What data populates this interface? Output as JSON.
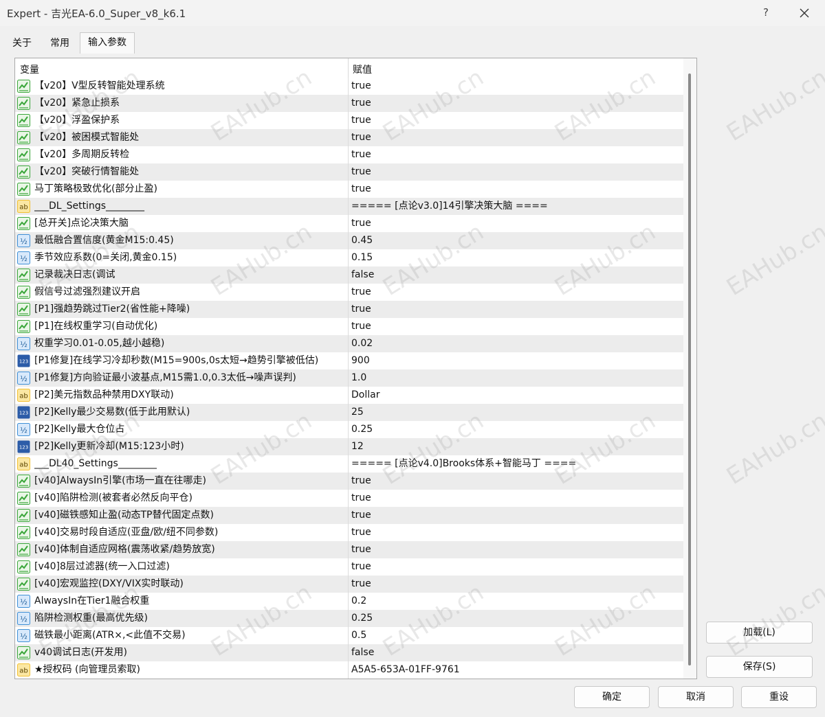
{
  "window": {
    "title": "Expert - 吉光EA-6.0_Super_v8_k6.1",
    "help_glyph": "?",
    "close_icon": "close-icon"
  },
  "tabs": [
    {
      "label": "关于",
      "active": false
    },
    {
      "label": "常用",
      "active": false
    },
    {
      "label": "输入参数",
      "active": true
    }
  ],
  "table": {
    "headers": {
      "variable": "变量",
      "value": "赋值"
    },
    "rows": [
      {
        "icon": "bool",
        "name": "【v20】V型反转智能处理系统",
        "value": "true"
      },
      {
        "icon": "bool",
        "name": "【v20】紧急止损系",
        "value": "true"
      },
      {
        "icon": "bool",
        "name": "【v20】浮盈保护系",
        "value": "true"
      },
      {
        "icon": "bool",
        "name": "【v20】被困模式智能处",
        "value": "true"
      },
      {
        "icon": "bool",
        "name": "【v20】多周期反转检",
        "value": "true"
      },
      {
        "icon": "bool",
        "name": "【v20】突破行情智能处",
        "value": "true"
      },
      {
        "icon": "bool",
        "name": "马丁策略极致优化(部分止盈)",
        "value": "true"
      },
      {
        "icon": "string",
        "name": "___DL_Settings________",
        "value": "===== [点论v3.0]14引擎决策大脑 ===="
      },
      {
        "icon": "bool",
        "name": "[总开关]点论决策大脑",
        "value": "true"
      },
      {
        "icon": "double",
        "name": "最低融合置信度(黄金M15:0.45)",
        "value": "0.45"
      },
      {
        "icon": "double",
        "name": "季节效应系数(0=关闭,黄金0.15)",
        "value": "0.15"
      },
      {
        "icon": "bool",
        "name": "记录裁决日志(调试",
        "value": "false"
      },
      {
        "icon": "bool",
        "name": "假信号过滤强烈建议开启",
        "value": "true"
      },
      {
        "icon": "bool",
        "name": "[P1]强趋势跳过Tier2(省性能+降噪)",
        "value": "true"
      },
      {
        "icon": "bool",
        "name": "[P1]在线权重学习(自动优化)",
        "value": "true"
      },
      {
        "icon": "double",
        "name": "权重学习0.01-0.05,越小越稳)",
        "value": "0.02"
      },
      {
        "icon": "int",
        "name": "[P1修复]在线学习冷却秒数(M15=900s,0s太短→趋势引擎被低估)",
        "value": "900"
      },
      {
        "icon": "double",
        "name": "[P1修复]方向验证最小波基点,M15需1.0,0.3太低→噪声误判)",
        "value": "1.0"
      },
      {
        "icon": "string",
        "name": "[P2]美元指数品种禁用DXY联动)",
        "value": "Dollar"
      },
      {
        "icon": "int",
        "name": "[P2]Kelly最少交易数(低于此用默认)",
        "value": "25"
      },
      {
        "icon": "double",
        "name": "[P2]Kelly最大仓位占",
        "value": "0.25"
      },
      {
        "icon": "int",
        "name": "[P2]Kelly更新冷却(M15:123小时)",
        "value": "12"
      },
      {
        "icon": "string",
        "name": "___DL40_Settings________",
        "value": "===== [点论v4.0]Brooks体系+智能马丁 ===="
      },
      {
        "icon": "bool",
        "name": "[v40]AlwaysIn引擎(市场一直在往哪走)",
        "value": "true"
      },
      {
        "icon": "bool",
        "name": "[v40]陷阱检测(被套者必然反向平仓)",
        "value": "true"
      },
      {
        "icon": "bool",
        "name": "[v40]磁铁感知止盈(动态TP替代固定点数)",
        "value": "true"
      },
      {
        "icon": "bool",
        "name": "[v40]交易时段自适应(亚盘/欧/纽不同参数)",
        "value": "true"
      },
      {
        "icon": "bool",
        "name": "[v40]体制自适应网格(震荡收紧/趋势放宽)",
        "value": "true"
      },
      {
        "icon": "bool",
        "name": "[v40]8层过滤器(统一入口过滤)",
        "value": "true"
      },
      {
        "icon": "bool",
        "name": "[v40]宏观监控(DXY/VIX实时联动)",
        "value": "true"
      },
      {
        "icon": "double",
        "name": "AlwaysIn在Tier1融合权重",
        "value": "0.2"
      },
      {
        "icon": "double",
        "name": "陷阱检测权重(最高优先级)",
        "value": "0.25"
      },
      {
        "icon": "double",
        "name": "磁铁最小距离(ATR×,<此值不交易)",
        "value": "0.5"
      },
      {
        "icon": "bool",
        "name": "v40调试日志(开发用)",
        "value": "false"
      },
      {
        "icon": "string",
        "name": "★授权码 (向管理员索取)",
        "value": "A5A5-653A-01FF-9761"
      }
    ]
  },
  "icon_legend": {
    "bool": {
      "label": "",
      "bg": "#3aa63a"
    },
    "string": {
      "label": "ab",
      "bg": "#f2c033"
    },
    "double": {
      "label": "½",
      "bg": "#3e8fd6"
    },
    "int": {
      "label": "123",
      "bg": "#2c5ca8"
    }
  },
  "side_buttons": {
    "load": "加载(L)",
    "save": "保存(S)"
  },
  "bottom_buttons": {
    "ok": "确定",
    "cancel": "取消",
    "reset": "重设"
  },
  "watermark_text": "EAHub.cn"
}
